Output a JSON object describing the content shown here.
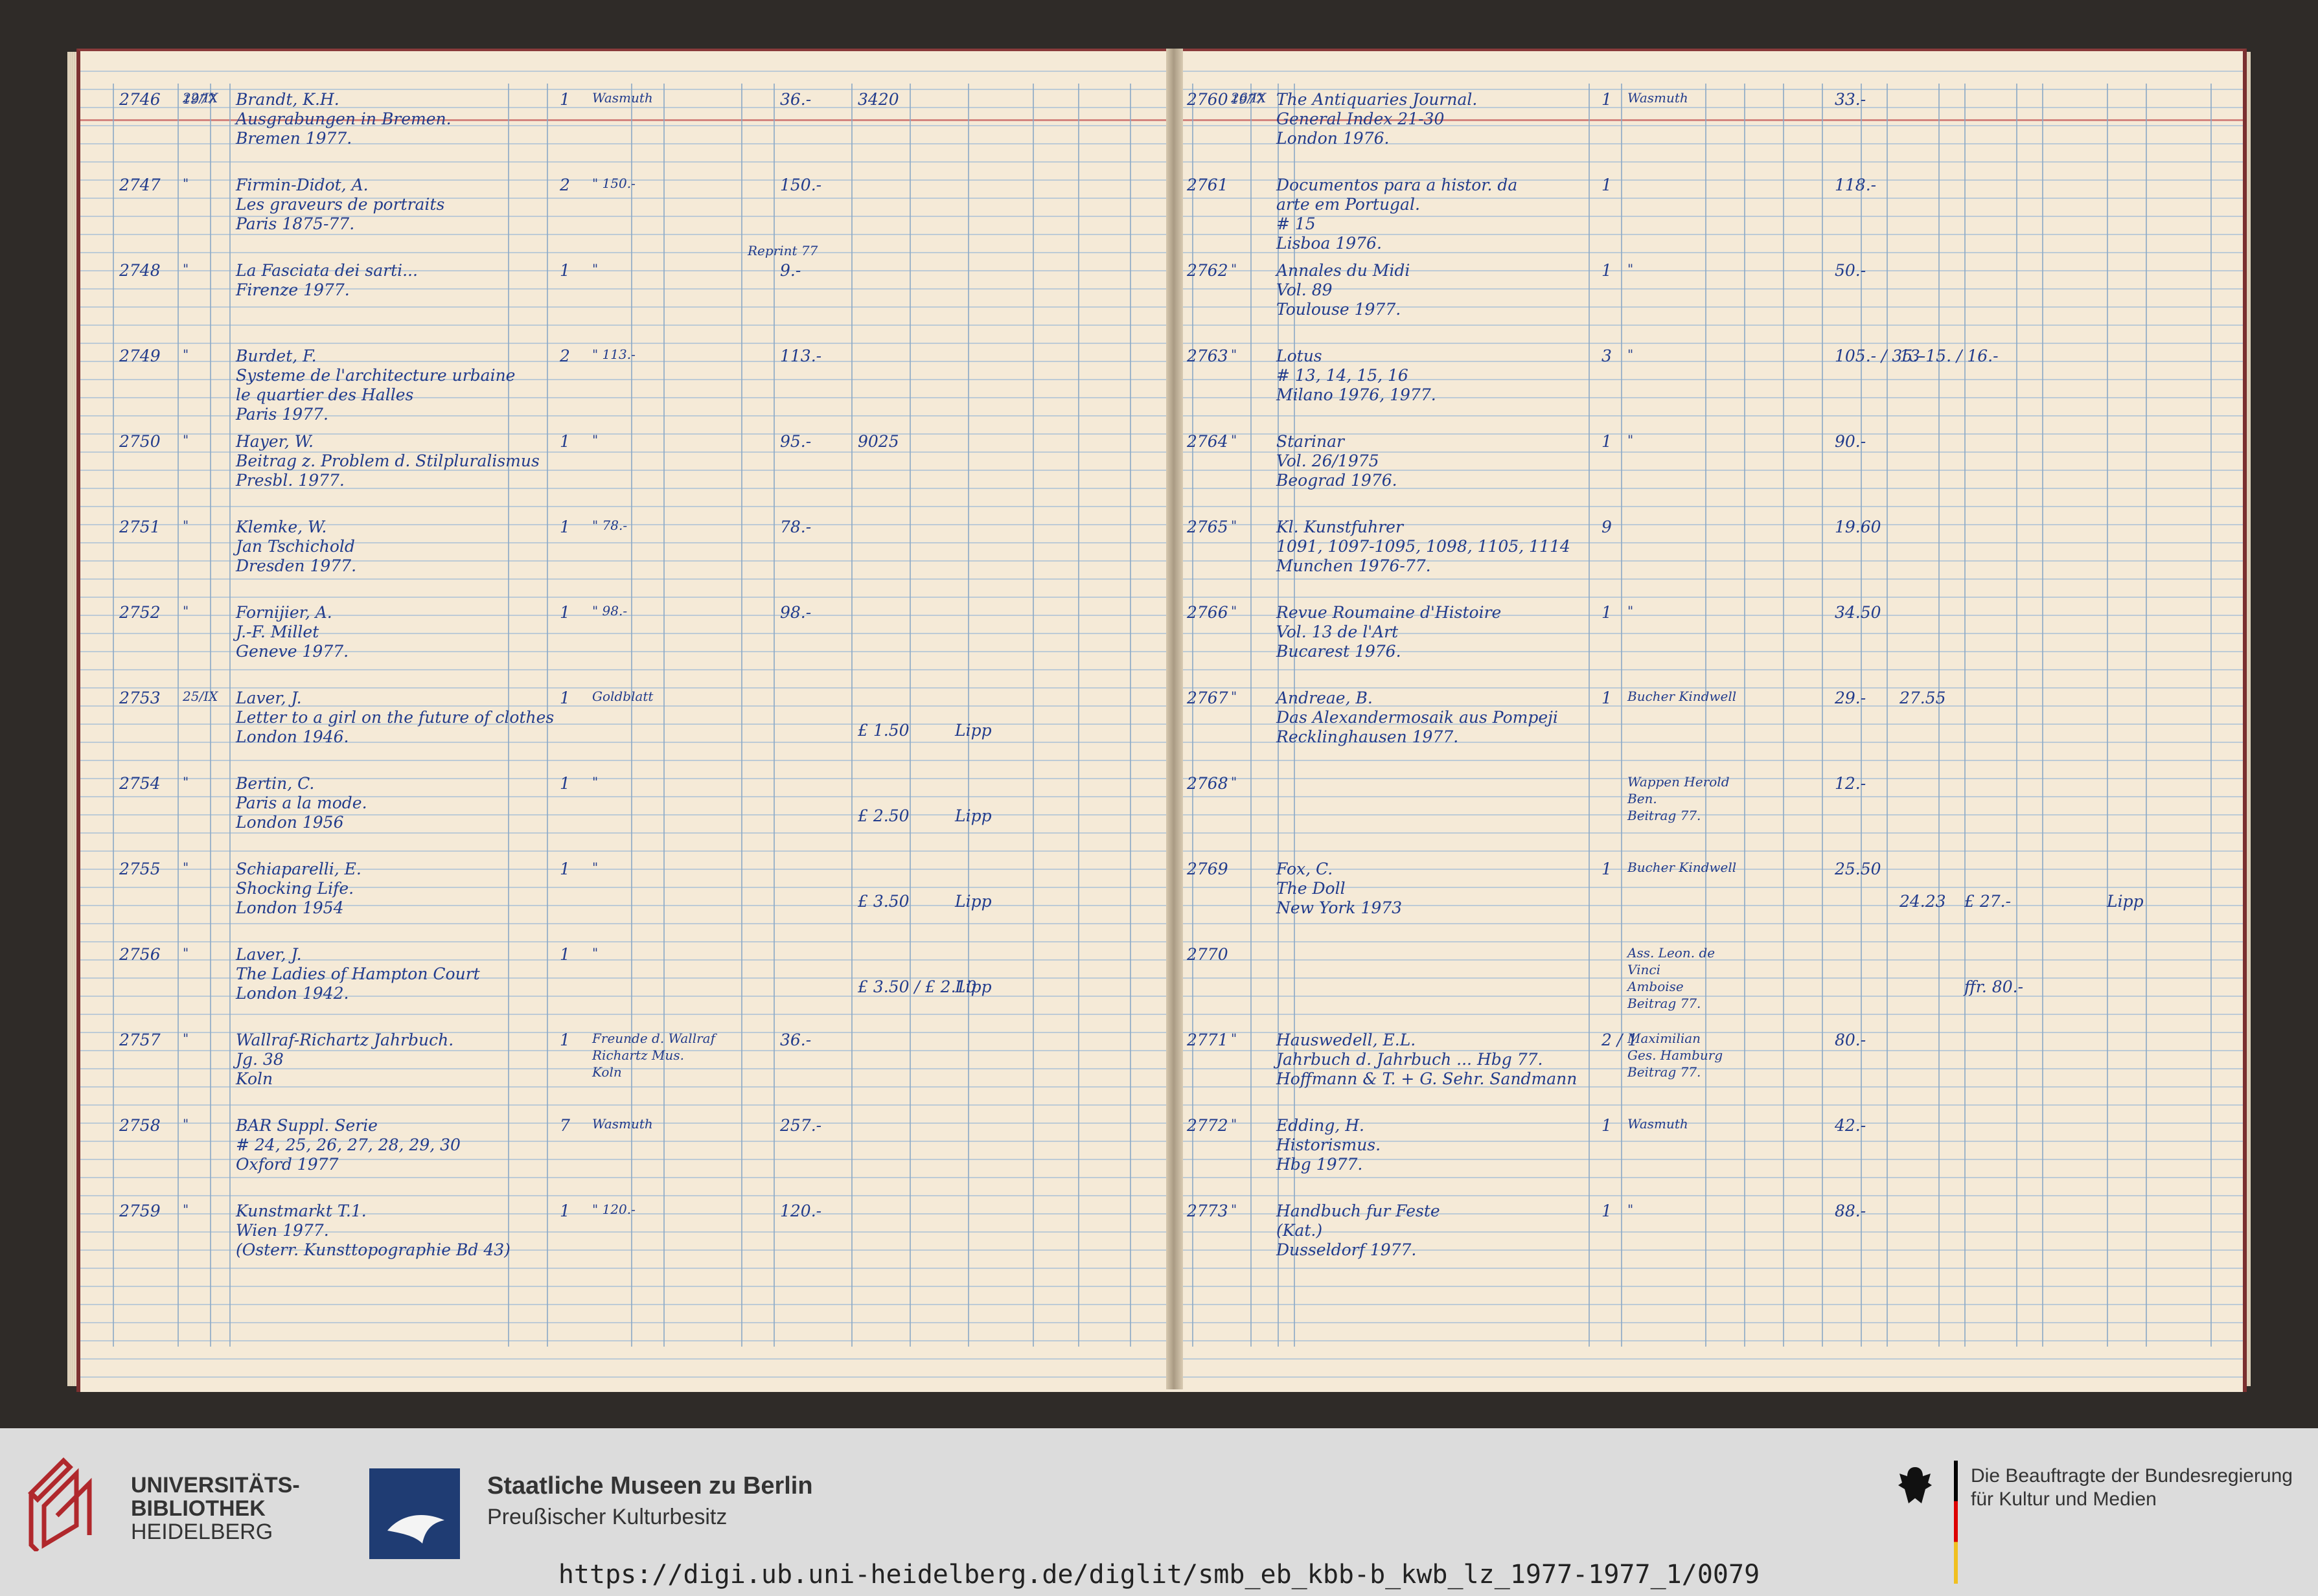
{
  "left_page": {
    "year_heading": "1977",
    "entries": [
      {
        "nr": "2746",
        "date": "22/IX",
        "title": [
          "Brandt, K.H.",
          "Ausgrabungen in Bremen.",
          "Bremen 1977."
        ],
        "count": "1",
        "supplier": [
          "Wasmuth"
        ],
        "amount": "36.-",
        "extra": "3420"
      },
      {
        "nr": "2747",
        "date": "\"",
        "title": [
          "Firmin-Didot, A.",
          "Les graveurs de portraits",
          "Paris 1875-77."
        ],
        "count": "2",
        "supplier": [
          "\" 150.-"
        ],
        "amount": "150.-",
        "extra": ""
      },
      {
        "nr": "2748",
        "date": "\"",
        "title": [
          "La Fasciata dei sarti...",
          "Firenze 1977."
        ],
        "count": "1",
        "supplier": [
          "\""
        ],
        "amount": "9.-",
        "extra": "",
        "note": "Reprint 77"
      },
      {
        "nr": "2749",
        "date": "\"",
        "title": [
          "Burdet, F.",
          "Systeme de l'architecture urbaine",
          "le quartier des Halles",
          "Paris 1977."
        ],
        "count": "2",
        "supplier": [
          "\" 113.-"
        ],
        "amount": "113.-",
        "extra": ""
      },
      {
        "nr": "2750",
        "date": "\"",
        "title": [
          "Hayer, W.",
          "Beitrag z. Problem d. Stilpluralismus",
          "Presbl. 1977."
        ],
        "count": "1",
        "supplier": [
          "\""
        ],
        "amount": "95.-",
        "extra": "9025"
      },
      {
        "nr": "2751",
        "date": "\"",
        "title": [
          "Klemke, W.",
          "Jan Tschichold",
          "Dresden 1977."
        ],
        "count": "1",
        "supplier": [
          "\" 78.-"
        ],
        "amount": "78.-",
        "extra": ""
      },
      {
        "nr": "2752",
        "date": "\"",
        "title": [
          "Fornijier, A.",
          "J.-F. Millet",
          "Geneve 1977."
        ],
        "count": "1",
        "supplier": [
          "\" 98.-"
        ],
        "amount": "98.-",
        "extra": ""
      },
      {
        "nr": "2753",
        "date": "25/IX",
        "title": [
          "Laver, J.",
          "Letter to a girl on the future of clothes",
          "London 1946."
        ],
        "count": "1",
        "supplier": [
          "Goldblatt"
        ],
        "amount": "",
        "extra": "£ 1.50",
        "third": "Lipp"
      },
      {
        "nr": "2754",
        "date": "\"",
        "title": [
          "Bertin, C.",
          "Paris a la mode.",
          "London 1956"
        ],
        "count": "1",
        "supplier": [
          "\""
        ],
        "amount": "",
        "extra": "£ 2.50",
        "third": "Lipp"
      },
      {
        "nr": "2755",
        "date": "\"",
        "title": [
          "Schiaparelli, E.",
          "Shocking Life.",
          "London 1954"
        ],
        "count": "1",
        "supplier": [
          "\""
        ],
        "amount": "",
        "extra": "£ 3.50",
        "third": "Lipp"
      },
      {
        "nr": "2756",
        "date": "\"",
        "title": [
          "Laver, J.",
          "The Ladies of Hampton Court",
          "London 1942."
        ],
        "count": "1",
        "supplier": [
          "\""
        ],
        "amount": "",
        "extra": "£ 3.50 / £ 2.10",
        "third": "Lipp"
      },
      {
        "nr": "2757",
        "date": "\"",
        "title": [
          "Wallraf-Richartz Jahrbuch.",
          "Jg. 38",
          "Koln"
        ],
        "count": "1",
        "supplier": [
          "Freunde d. Wallraf",
          "Richartz Mus.",
          "Koln"
        ],
        "amount": "36.-",
        "extra": ""
      },
      {
        "nr": "2758",
        "date": "\"",
        "title": [
          "BAR Suppl. Serie",
          "# 24, 25, 26, 27, 28, 29, 30",
          "Oxford 1977"
        ],
        "count": "7",
        "supplier": [
          "Wasmuth"
        ],
        "amount": "257.-",
        "extra": ""
      },
      {
        "nr": "2759",
        "date": "\"",
        "title": [
          "Kunstmarkt T.1.",
          "Wien 1977.",
          "(Osterr. Kunsttopographie Bd 43)"
        ],
        "count": "1",
        "supplier": [
          "\" 120.-"
        ],
        "amount": "120.-",
        "extra": ""
      }
    ]
  },
  "right_page": {
    "year_heading": "1977",
    "entries": [
      {
        "nr": "2760",
        "date": "26/IX",
        "title": [
          "The Antiquaries Journal.",
          "General Index 21-30",
          "London 1976."
        ],
        "count": "1",
        "supplier": [
          "Wasmuth"
        ],
        "amount": "33.-",
        "extra": ""
      },
      {
        "nr": "2761",
        "date": "",
        "title": [
          "Documentos para a histor. da",
          "arte em Portugal.",
          "# 15",
          "Lisboa 1976."
        ],
        "count": "1",
        "supplier": [
          ""
        ],
        "amount": "118.-",
        "extra": ""
      },
      {
        "nr": "2762",
        "date": "\"",
        "title": [
          "Annales du Midi",
          "Vol. 89",
          "Toulouse 1977."
        ],
        "count": "1",
        "supplier": [
          "\""
        ],
        "amount": "50.-",
        "extra": ""
      },
      {
        "nr": "2763",
        "date": "\"",
        "title": [
          "Lotus",
          "# 13, 14, 15, 16",
          "Milano 1976, 1977."
        ],
        "count": "3",
        "supplier": [
          "\""
        ],
        "amount": "105.- / 35.-",
        "extra": "13-15. / 16.-"
      },
      {
        "nr": "2764",
        "date": "\"",
        "title": [
          "Starinar",
          "Vol. 26/1975",
          "Beograd 1976."
        ],
        "count": "1",
        "supplier": [
          "\""
        ],
        "amount": "90.-",
        "extra": ""
      },
      {
        "nr": "2765",
        "date": "\"",
        "title": [
          "Kl. Kunstfuhrer",
          "1091, 1097-1095, 1098, 1105, 1114",
          "Munchen 1976-77."
        ],
        "count": "9",
        "supplier": [
          ""
        ],
        "amount": "19.60",
        "extra": ""
      },
      {
        "nr": "2766",
        "date": "\"",
        "title": [
          "Revue Roumaine d'Histoire",
          "Vol. 13 de l'Art",
          "Bucarest 1976."
        ],
        "count": "1",
        "supplier": [
          "\""
        ],
        "amount": "34.50",
        "extra": ""
      },
      {
        "nr": "2767",
        "date": "\"",
        "title": [
          "Andreae, B.",
          "Das Alexandermosaik aus Pompeji",
          "Recklinghausen 1977."
        ],
        "count": "1",
        "supplier": [
          "Bucher Kindwell"
        ],
        "amount": "29.-",
        "extra": "27.55"
      },
      {
        "nr": "2768",
        "date": "\"",
        "title": [
          ""
        ],
        "count": "",
        "supplier": [
          "Wappen Herold",
          "Ben.",
          "Beitrag 77."
        ],
        "amount": "12.-",
        "extra": ""
      },
      {
        "nr": "2769",
        "date": "",
        "title": [
          "Fox, C.",
          "The Doll",
          "New York 1973"
        ],
        "count": "1",
        "supplier": [
          "Bucher Kindwell"
        ],
        "amount": "25.50",
        "extra": "24.23",
        "third": "£ 27.-",
        "fourth": "Lipp"
      },
      {
        "nr": "2770",
        "date": "",
        "title": [
          ""
        ],
        "count": "",
        "supplier": [
          "Ass. Leon. de",
          "Vinci",
          "Amboise",
          "Beitrag 77."
        ],
        "amount": "",
        "extra": "",
        "third": "ffr. 80.-"
      },
      {
        "nr": "2771",
        "date": "\"",
        "title": [
          "Hauswedell, E.L.",
          "Jahrbuch d. Jahrbuch ... Hbg 77.",
          "Hoffmann & T. + G. Sehr. Sandmann"
        ],
        "count": "2 / 1",
        "supplier": [
          "Maximilian",
          "Ges. Hamburg",
          "Beitrag 77."
        ],
        "amount": "80.-",
        "extra": ""
      },
      {
        "nr": "2772",
        "date": "\"",
        "title": [
          "Edding, H.",
          "Historismus.",
          "Hbg 1977."
        ],
        "count": "1",
        "supplier": [
          "Wasmuth"
        ],
        "amount": "42.-",
        "extra": ""
      },
      {
        "nr": "2773",
        "date": "\"",
        "title": [
          "Handbuch fur Feste",
          "(Kat.)",
          "Dusseldorf 1977."
        ],
        "count": "1",
        "supplier": [
          "\""
        ],
        "amount": "88.-",
        "extra": ""
      }
    ]
  },
  "footer": {
    "ub_lines": [
      "UNIVERSITÄTS-",
      "BIBLIOTHEK",
      "HEIDELBERG"
    ],
    "smb_name": "Staatliche Museen zu Berlin",
    "smb_sub": "Preußischer Kulturbesitz",
    "bkm_lines": [
      "Die Beauftragte der Bundesregierung",
      "für Kultur und Medien"
    ],
    "url": "https://digi.ub.uni-heidelberg.de/diglit/smb_eb_kbb-b_kwb_lz_1977-1977_1/0079"
  }
}
